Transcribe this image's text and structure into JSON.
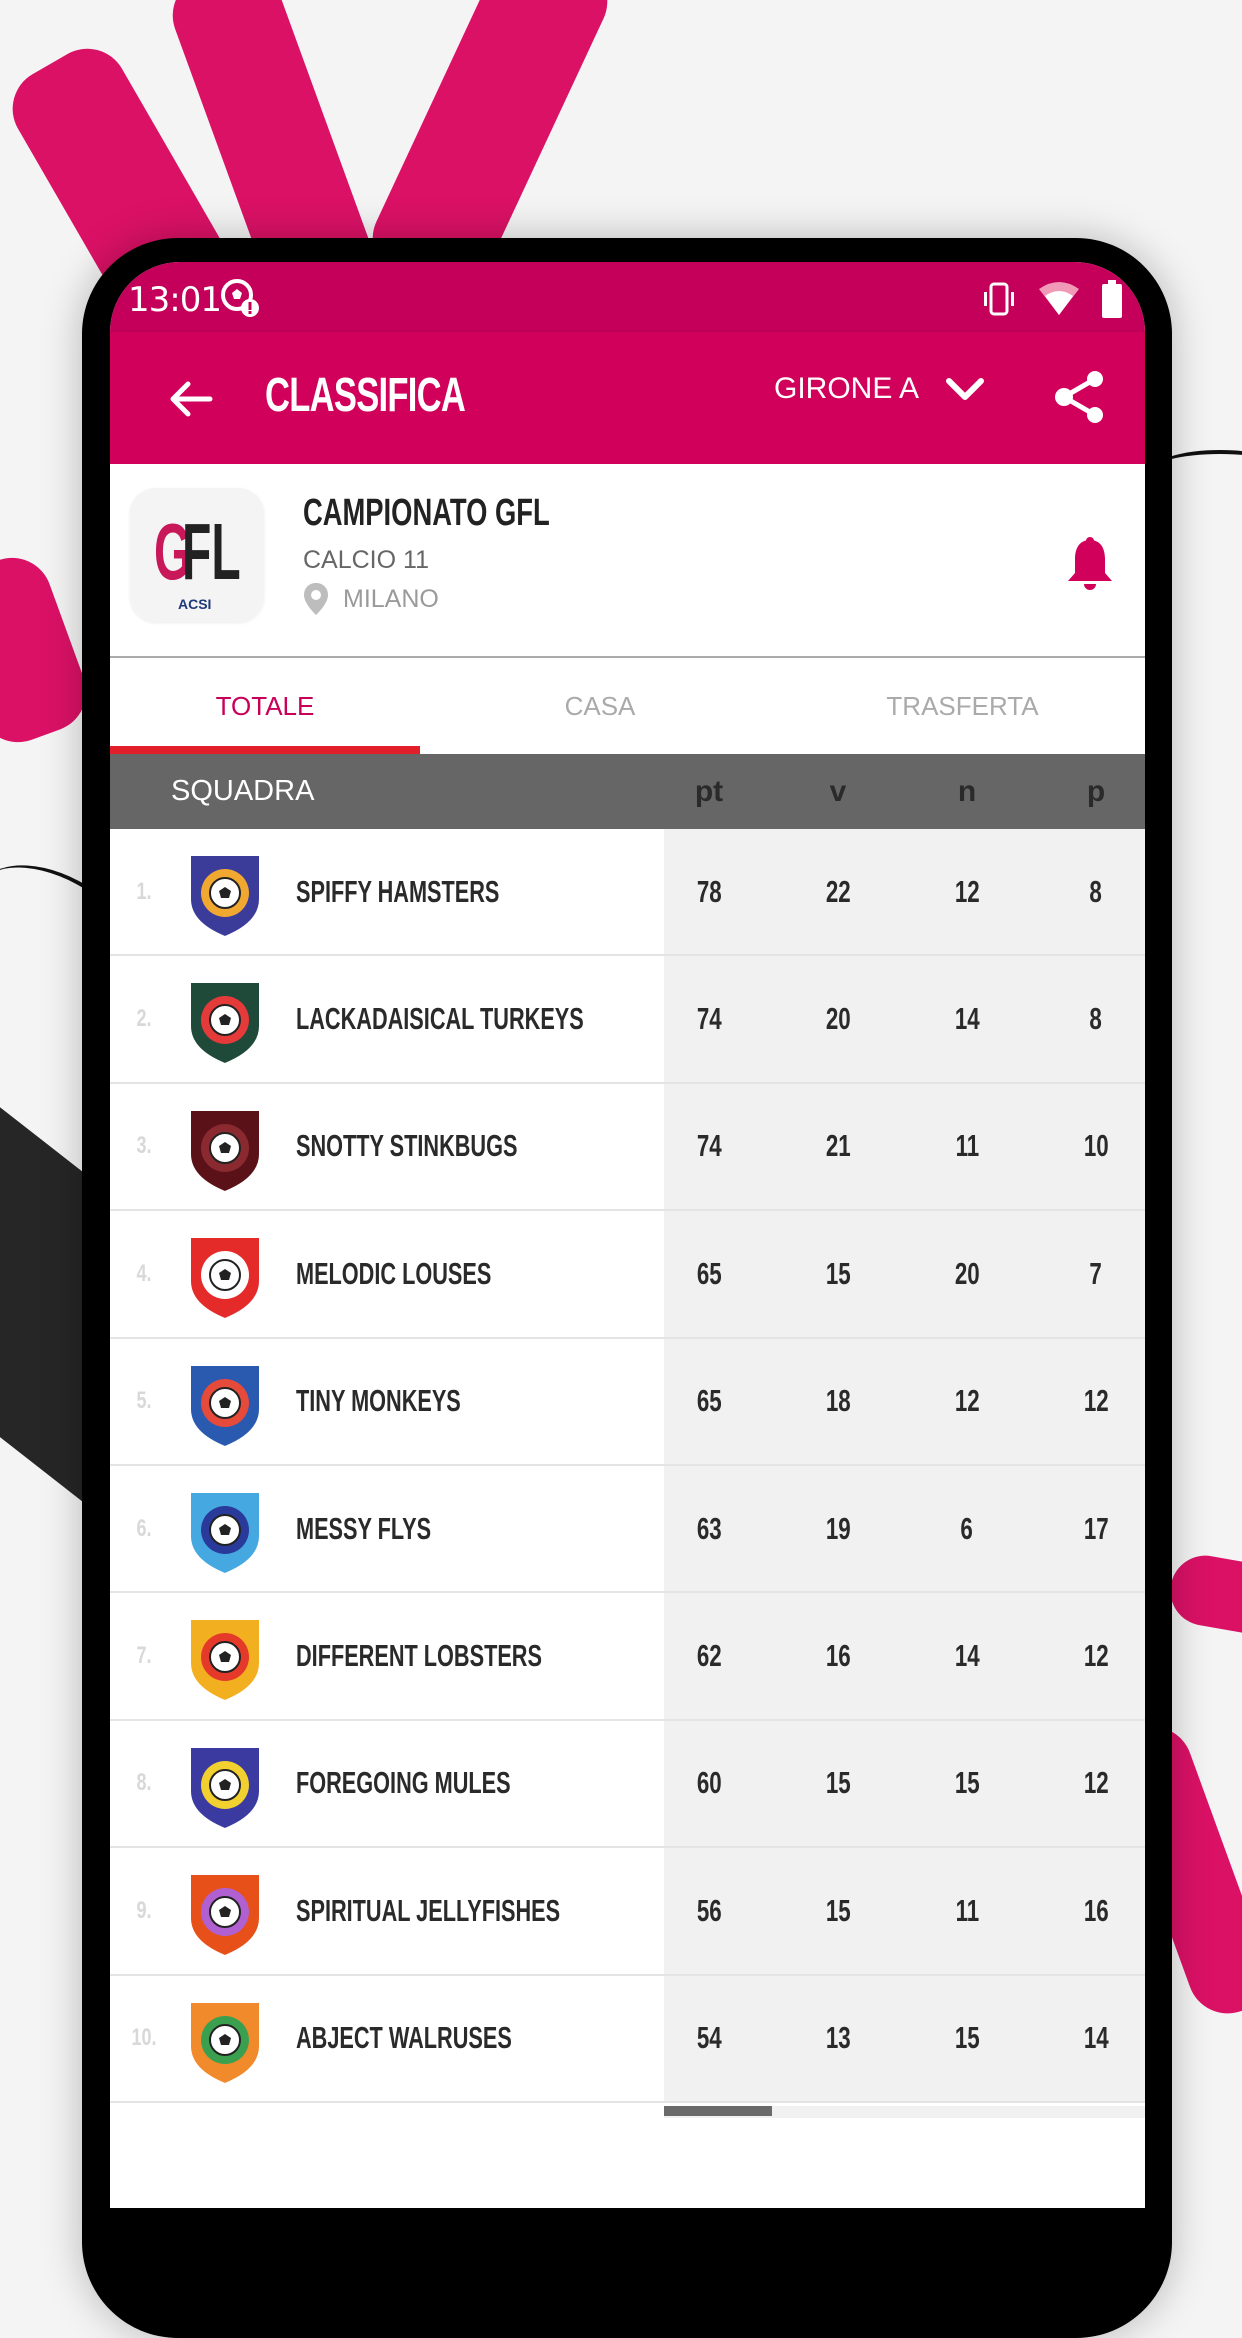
{
  "status_bar": {
    "time": "13:01",
    "notification_icon": "soccer-ball-alert-icon",
    "icons": [
      "vibrate-icon",
      "wifi-icon",
      "battery-icon"
    ]
  },
  "app_bar": {
    "back_icon": "arrow-left-icon",
    "title": "CLASSIFICA",
    "group_selector": "GIRONE A",
    "dropdown_icon": "chevron-down-icon",
    "share_icon": "share-icon",
    "color": "#d1005a"
  },
  "league": {
    "logo_text_primary": "G",
    "logo_text_secondary": "FL",
    "logo_sub": "ACSI",
    "name": "CAMPIONATO GFL",
    "sport": "CALCIO 11",
    "location": "MILANO",
    "location_icon": "map-pin-icon",
    "bell_icon": "bell-icon"
  },
  "tabs": [
    {
      "label": "TOTALE",
      "active": true
    },
    {
      "label": "CASA",
      "active": false
    },
    {
      "label": "TRASFERTA",
      "active": false
    }
  ],
  "table": {
    "headers": {
      "team": "SQUADRA",
      "pt": "pt",
      "v": "v",
      "n": "n",
      "p": "p"
    },
    "rows": [
      {
        "pos": "1.",
        "team": "SPIFFY HAMSTERS",
        "pt": "78",
        "v": "22",
        "n": "12",
        "p": "8",
        "crest": {
          "c1": "#3b3b9a",
          "c2": "#f0a830"
        }
      },
      {
        "pos": "2.",
        "team": "LACKADAISICAL TURKEYS",
        "pt": "74",
        "v": "20",
        "n": "14",
        "p": "8",
        "crest": {
          "c1": "#1f4a3a",
          "c2": "#e53a3a"
        }
      },
      {
        "pos": "3.",
        "team": "SNOTTY STINKBUGS",
        "pt": "74",
        "v": "21",
        "n": "11",
        "p": "10",
        "crest": {
          "c1": "#5a1218",
          "c2": "#8a2a30"
        }
      },
      {
        "pos": "4.",
        "team": "MELODIC LOUSES",
        "pt": "65",
        "v": "15",
        "n": "20",
        "p": "7",
        "crest": {
          "c1": "#e52a2a",
          "c2": "#ffffff"
        }
      },
      {
        "pos": "5.",
        "team": "TINY MONKEYS",
        "pt": "65",
        "v": "18",
        "n": "12",
        "p": "12",
        "crest": {
          "c1": "#2a5ab0",
          "c2": "#e54a3a"
        }
      },
      {
        "pos": "6.",
        "team": "MESSY FLYS",
        "pt": "63",
        "v": "19",
        "n": "6",
        "p": "17",
        "crest": {
          "c1": "#45a8e0",
          "c2": "#2a3a9a"
        }
      },
      {
        "pos": "7.",
        "team": "DIFFERENT LOBSTERS",
        "pt": "62",
        "v": "16",
        "n": "14",
        "p": "12",
        "crest": {
          "c1": "#f2b020",
          "c2": "#e53a2a"
        }
      },
      {
        "pos": "8.",
        "team": "FOREGOING MULES",
        "pt": "60",
        "v": "15",
        "n": "15",
        "p": "12",
        "crest": {
          "c1": "#3a3aa0",
          "c2": "#f2d030"
        }
      },
      {
        "pos": "9.",
        "team": "SPIRITUAL JELLYFISHES",
        "pt": "56",
        "v": "15",
        "n": "11",
        "p": "16",
        "crest": {
          "c1": "#e8501a",
          "c2": "#b060d0"
        }
      },
      {
        "pos": "10.",
        "team": "ABJECT WALRUSES",
        "pt": "54",
        "v": "13",
        "n": "15",
        "p": "14",
        "crest": {
          "c1": "#f08a2a",
          "c2": "#3aa050"
        }
      }
    ]
  }
}
